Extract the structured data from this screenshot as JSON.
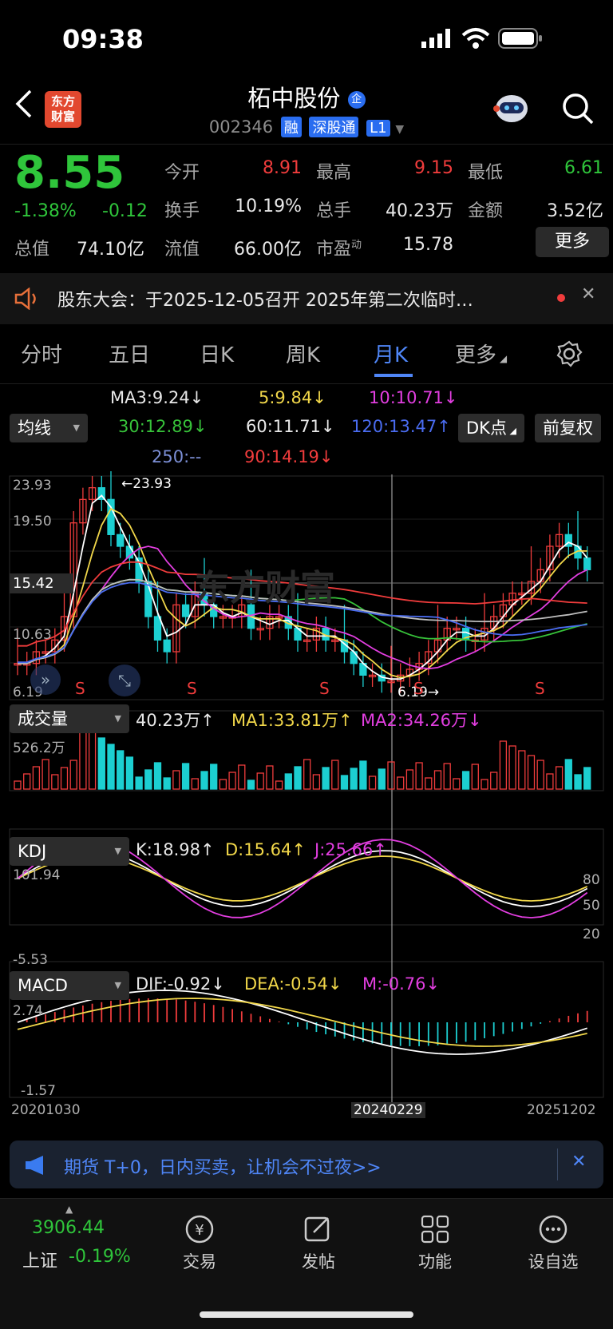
{
  "status": {
    "time": "09:38"
  },
  "header": {
    "logo_text_1": "东方",
    "logo_text_2": "财富",
    "stock_name": "柘中股份",
    "stock_code": "002346",
    "tags": [
      "融",
      "深股通",
      "L1"
    ],
    "name_badge": "企"
  },
  "quote": {
    "price": "8.55",
    "change_pct": "-1.38%",
    "change": "-0.12",
    "items": [
      {
        "label": "今开",
        "value": "8.91",
        "color": "red"
      },
      {
        "label": "最高",
        "value": "9.15",
        "color": "red"
      },
      {
        "label": "最低",
        "value": "6.61",
        "color": "green"
      },
      {
        "label": "换手",
        "value": "10.19%",
        "color": "white"
      },
      {
        "label": "总手",
        "value": "40.23万",
        "color": "white"
      },
      {
        "label": "金额",
        "value": "3.52亿",
        "color": "white"
      },
      {
        "label": "流值",
        "value": "66.00亿",
        "color": "white"
      },
      {
        "label": "市盈",
        "value": "15.78",
        "color": "white"
      }
    ],
    "total_value_label": "总值",
    "total_value": "74.10亿",
    "pe_superscript": "动",
    "more_label": "更多"
  },
  "notice": {
    "text": "股东大会：于2025-12-05召开 2025年第二次临时…"
  },
  "tabs": [
    "分时",
    "五日",
    "日K",
    "周K",
    "月K",
    "更多"
  ],
  "active_tab": "月K",
  "ma": {
    "selector": "均线",
    "dk_button": "DK点",
    "restore_button": "前复权",
    "ma3": "MA3:9.24↓",
    "ma5": "5:9.84↓",
    "ma10": "10:10.71↓",
    "ma30": "30:12.89↓",
    "ma60": "60:11.71↓",
    "ma120": "120:13.47↑",
    "ma250": "250:--",
    "ma90": "90:14.19↓"
  },
  "kline": {
    "y_labels": [
      "23.93",
      "19.50",
      "15.42",
      "10.63",
      "6.19"
    ],
    "max_marker": "←23.93",
    "min_marker": "6.19→",
    "signal": "S",
    "watermark": "东方财富"
  },
  "volume": {
    "selector": "成交量",
    "vol": "40.23万↑",
    "ma1": "MA1:33.81万↑",
    "ma2": "MA2:34.26万↓",
    "y_label": "526.2万"
  },
  "kdj": {
    "selector": "KDJ",
    "k": "K:18.98↑",
    "d": "D:15.64↑",
    "j": "J:25.66↑",
    "y_top": "101.94",
    "y_bottom": "-5.53",
    "levels": [
      "80",
      "50",
      "20"
    ]
  },
  "macd": {
    "selector": "MACD",
    "dif": "DIF:-0.92↓",
    "dea": "DEA:-0.54↓",
    "m": "M:-0.76↓",
    "y_top": "2.74",
    "y_bottom": "-1.57",
    "dates": [
      "20201030",
      "20240229",
      "20251202"
    ]
  },
  "banner": {
    "text": "期货 T+0，日内买卖，让机会不过夜>>"
  },
  "nav": {
    "index_value": "3906.44",
    "index_name": "上证",
    "index_change": "-0.19%",
    "items": [
      "交易",
      "发帖",
      "功能",
      "设自选"
    ]
  },
  "colors": {
    "up": "#f03c3c",
    "down": "#2fc53b",
    "accent": "#4f86f7",
    "cyan_bar": "#1ccfd1"
  }
}
